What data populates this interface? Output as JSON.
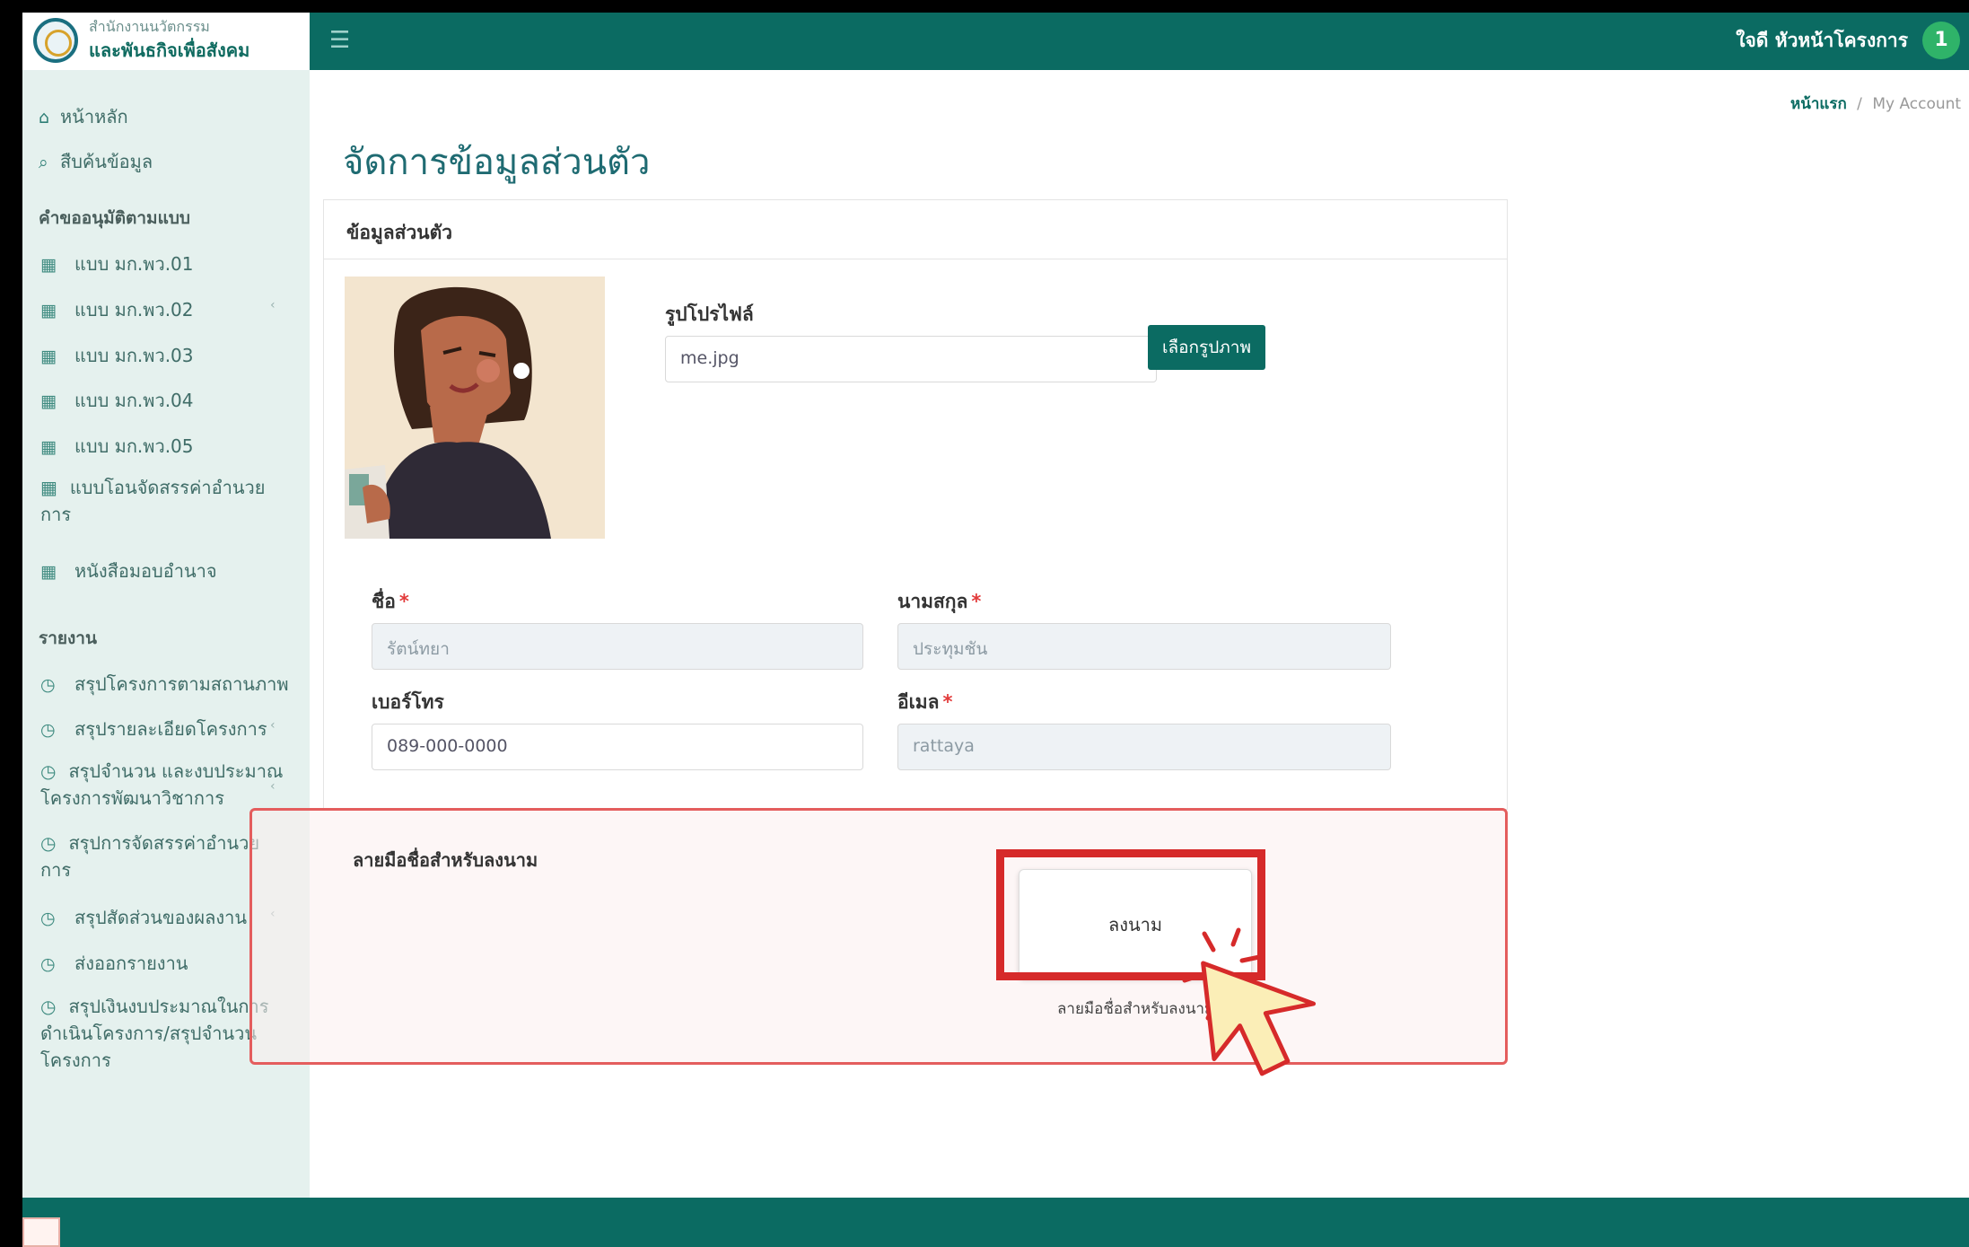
{
  "brand": {
    "line1": "สำนักงานนวัตกรรม",
    "line2": "และพันธกิจเพื่อสังคม"
  },
  "topbar": {
    "user_name": "ใจดี หัวหน้าโครงการ",
    "user_badge": "1"
  },
  "sidebar": {
    "home": "หน้าหลัก",
    "search": "สืบค้นข้อมูล",
    "section_forms": "คำขออนุมัติตามแบบ",
    "forms": [
      "แบบ มก.พว.01",
      "แบบ มก.พว.02",
      "แบบ มก.พว.03",
      "แบบ มก.พว.04",
      "แบบ มก.พว.05"
    ],
    "form_transfer_l1": "แบบโอนจัดสรรค่าอำนวย",
    "form_transfer_l2": "การ",
    "form_authority": "หนังสือมอบอำนาจ",
    "section_reports": "รายงาน",
    "reports": {
      "r1": "สรุปโครงการตามสถานภาพ",
      "r2": "สรุปรายละเอียดโครงการ",
      "r3_l1": "สรุปจำนวน และงบประมาณ",
      "r3_l2": "โครงการพัฒนาวิชาการ",
      "r4_l1": "สรุปการจัดสรรค่าอำนวย",
      "r4_l2": "การ",
      "r5": "สรุปสัดส่วนของผลงาน",
      "r6": "ส่งออกรายงาน",
      "r7_l1": "สรุปเงินงบประมาณในการ",
      "r7_l2": "ดำเนินโครงการ/สรุปจำนวน",
      "r7_l3": "โครงการ"
    }
  },
  "breadcrumb": {
    "home": "หน้าแรก",
    "sep": "/",
    "current": "My Account"
  },
  "page_title": "จัดการข้อมูลส่วนตัว",
  "card": {
    "header": "ข้อมูลส่วนตัว",
    "profile_label": "รูปโปรไฟล์",
    "profile_file": "me.jpg",
    "pick_button": "เลือกรูปภาพ",
    "first_name_label": "ชื่อ",
    "first_name_value": "รัตน์ทยา",
    "last_name_label": "นามสกุล",
    "last_name_value": "ประทุมชัน",
    "phone_label": "เบอร์โทร",
    "phone_value": "089-000-0000",
    "email_label": "อีเมล",
    "email_value": "rattaya",
    "required_mark": "*"
  },
  "signature": {
    "title": "ลายมือชื่อสำหรับลงนาม",
    "button": "ลงนาม",
    "caption": "ลายมือชื่อสำหรับลงนาม"
  },
  "colors": {
    "primary": "#0b6b62",
    "sidebar_bg": "#e5f1ee",
    "highlight": "#d62a2a",
    "badge": "#2fb369"
  },
  "icons": {
    "home": "home-icon",
    "search": "search-icon",
    "form": "table-icon",
    "report": "clock-icon",
    "menu": "hamburger-icon",
    "cursor": "pointer-cursor-icon"
  }
}
